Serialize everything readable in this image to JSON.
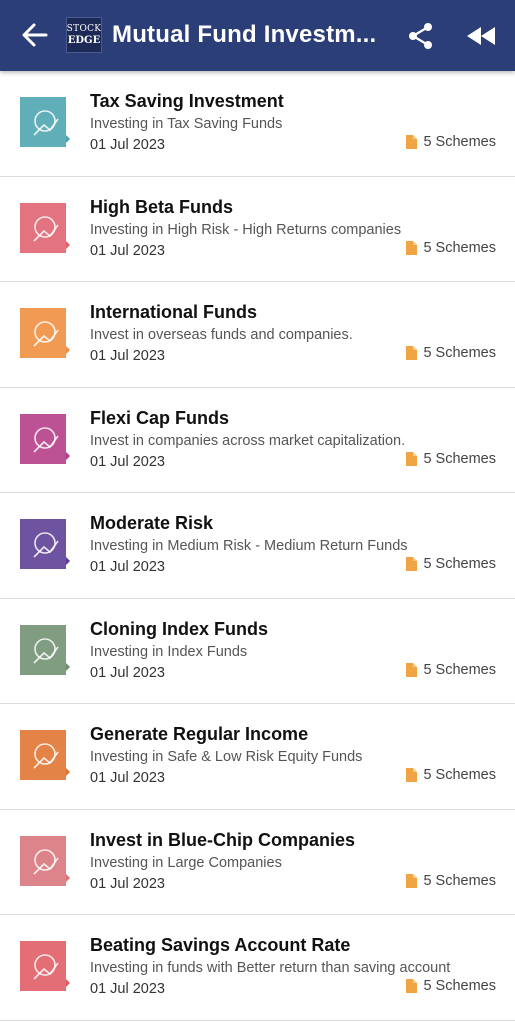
{
  "header": {
    "title": "Mutual Fund Investm...",
    "logo_line1": "STOCK",
    "logo_line2": "EDGE"
  },
  "items": [
    {
      "name": "Tax Saving Investment",
      "desc": "Investing in Tax Saving Funds",
      "date": "01 Jul 2023",
      "schemes": "5 Schemes",
      "color": "#4aa3ad",
      "icon": "tax-saving-icon"
    },
    {
      "name": "High Beta Funds",
      "desc": "Investing in High Risk - High Returns companies",
      "date": "01 Jul 2023",
      "schemes": "5 Schemes",
      "color": "#e0606e",
      "icon": "high-beta-icon"
    },
    {
      "name": "International Funds",
      "desc": "Invest in overseas funds and companies.",
      "date": "01 Jul 2023",
      "schemes": "5 Schemes",
      "color": "#ef8c3c",
      "icon": "globe-icon"
    },
    {
      "name": "Flexi Cap Funds",
      "desc": "Invest in companies across market capitalization.",
      "date": "01 Jul 2023",
      "schemes": "5 Schemes",
      "color": "#b33a85",
      "icon": "flexi-cap-icon"
    },
    {
      "name": "Moderate Risk",
      "desc": "Investing in Medium Risk - Medium Return Funds",
      "date": "01 Jul 2023",
      "schemes": "5 Schemes",
      "color": "#5b3d93",
      "icon": "moderate-risk-icon"
    },
    {
      "name": "Cloning Index Funds",
      "desc": "Investing in Index Funds",
      "date": "01 Jul 2023",
      "schemes": "5 Schemes",
      "color": "#6f8f70",
      "icon": "index-fund-icon"
    },
    {
      "name": "Generate Regular Income",
      "desc": "Investing in Safe & Low Risk Equity Funds",
      "date": "01 Jul 2023",
      "schemes": "5 Schemes",
      "color": "#e0722e",
      "icon": "regular-income-icon"
    },
    {
      "name": "Invest in Blue-Chip Companies",
      "desc": "Investing in Large Companies",
      "date": "01 Jul 2023",
      "schemes": "5 Schemes",
      "color": "#d8747a",
      "icon": "blue-chip-icon"
    },
    {
      "name": "Beating Savings Account Rate",
      "desc": "Investing in funds with Better return than saving account",
      "date": "01 Jul 2023",
      "schemes": "5 Schemes",
      "color": "#e05a64",
      "icon": "savings-icon"
    }
  ],
  "colors": {
    "appbar": "#2c3e78",
    "file_icon": "#f0a444"
  }
}
